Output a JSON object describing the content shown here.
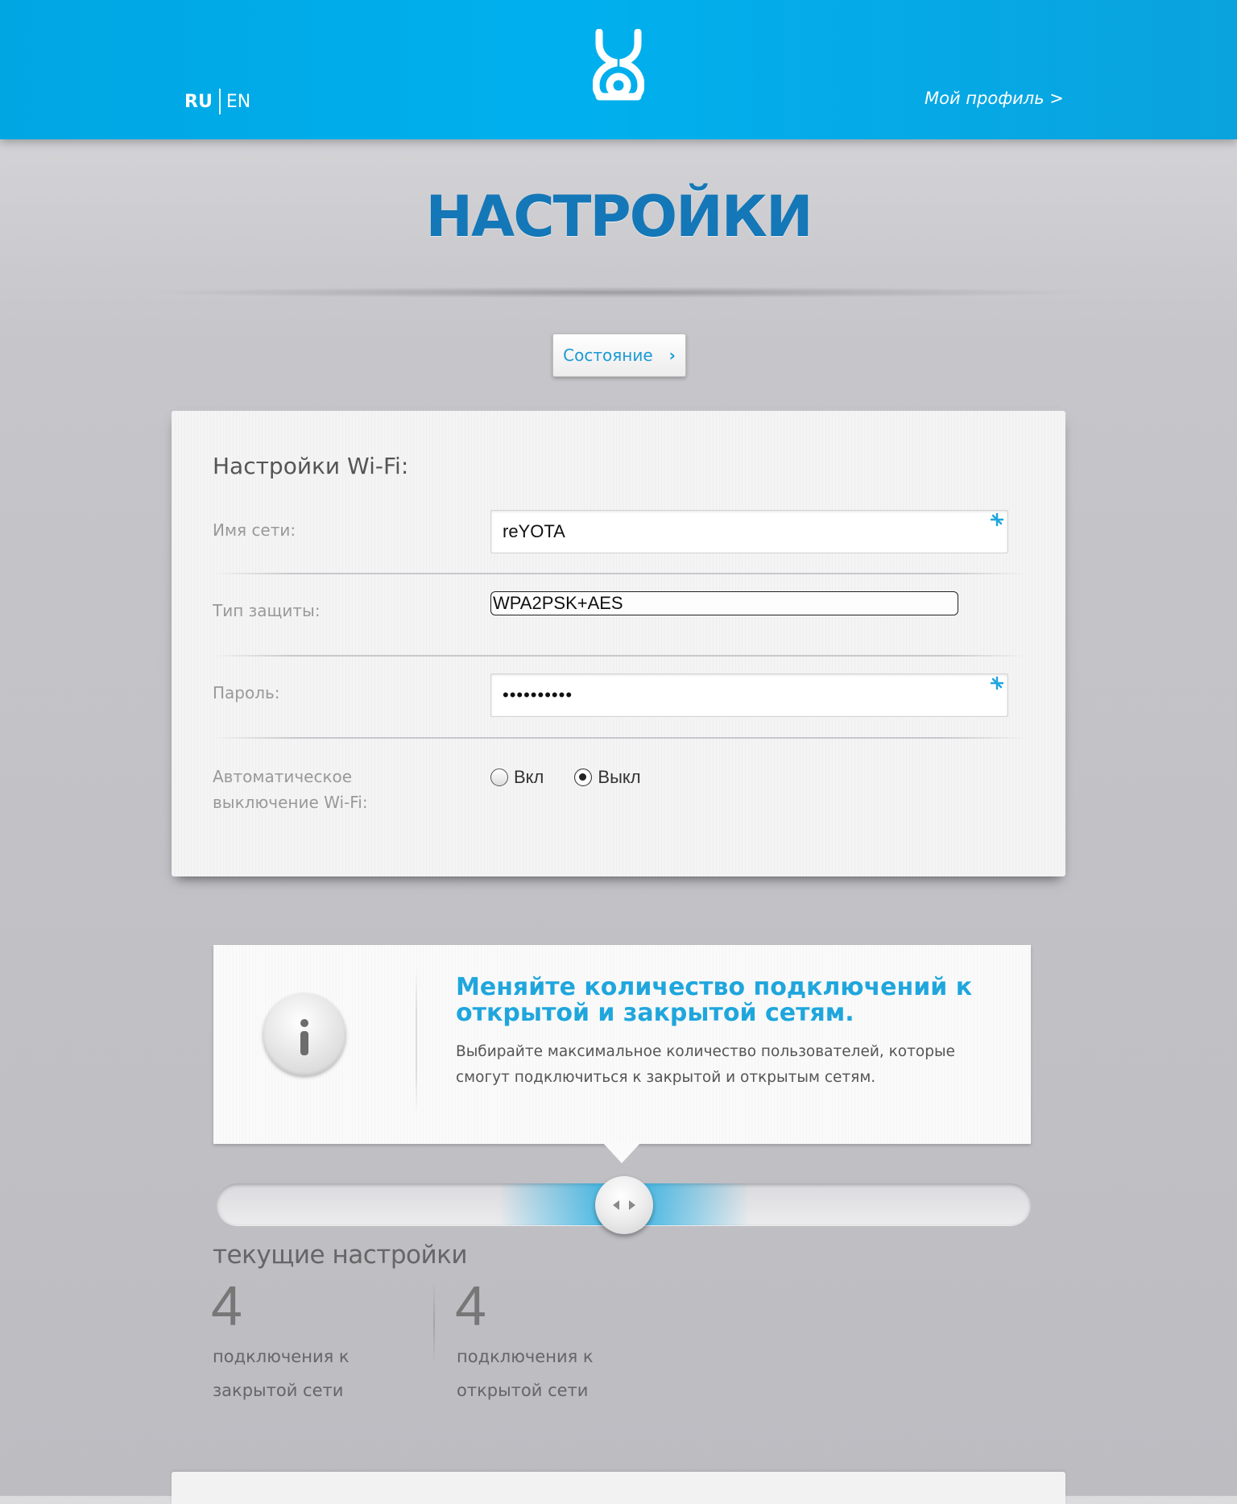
{
  "header": {
    "lang_ru": "RU",
    "lang_en": "EN",
    "profile_link": "Мой профиль >",
    "logo_icon": "yota-logo-icon"
  },
  "page_title": "НАСТРОЙКИ",
  "status_button": {
    "label": "Состояние",
    "chevron_icon": "chevron-right-icon"
  },
  "wifi_settings": {
    "heading": "Настройки Wi-Fi:",
    "network_name": {
      "label": "Имя сети:",
      "value": "reYOTA"
    },
    "security_type": {
      "label": "Тип защиты:",
      "value": "WPA2PSK+AES"
    },
    "password": {
      "label": "Пароль:",
      "value": "••••••••••"
    },
    "auto_off": {
      "label_line1": "Автоматическое",
      "label_line2": "выключение Wi-Fi:",
      "option_on": "Вкл",
      "option_off": "Выкл",
      "selected": "Выкл"
    }
  },
  "info": {
    "title": "Меняйте количество подключений к открытой и закрытой сетям.",
    "text": "Выбирайте максимальное количество пользователей, которые смогут подключиться к закрытой и открытым сетям.",
    "icon": "info-icon"
  },
  "connections_slider": {
    "position_fraction": 0.5
  },
  "current_settings": {
    "heading": "текущие настройки",
    "closed": {
      "count": "4",
      "label_line1": "подключения к",
      "label_line2": "закрытой сети"
    },
    "open": {
      "count": "4",
      "label_line1": "подключения к",
      "label_line2": "открытой сети"
    }
  },
  "colors": {
    "header_blue": "#00aeea",
    "title_blue": "#1477b7",
    "accent_blue": "#1fa6dd"
  }
}
